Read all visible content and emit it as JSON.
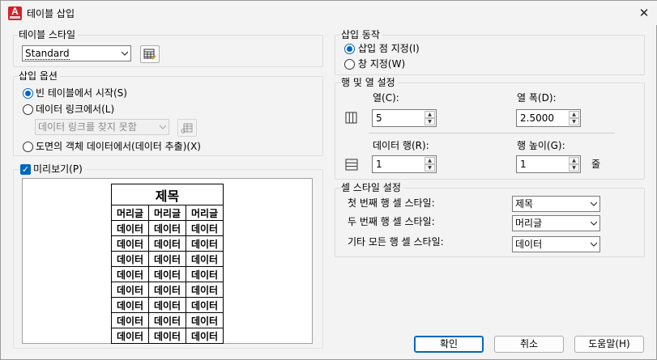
{
  "window": {
    "title": "테이블 삽입",
    "close": "✕"
  },
  "table_style": {
    "group_label": "테이블 스타일",
    "selected": "Standard"
  },
  "insert_options": {
    "group_label": "삽입 옵션",
    "opt_empty": "빈 테이블에서 시작(S)",
    "opt_link": "데이터 링크에서(L)",
    "link_combo": "데이터 링크를 찾지 못함",
    "opt_object": "도면의 객체 데이터에서(데이터 추출)(X)"
  },
  "preview": {
    "label": "미리보기(P)",
    "table": {
      "title": "제목",
      "headers": [
        "머리글",
        "머리글",
        "머리글"
      ],
      "rows": [
        [
          "데이터",
          "데이터",
          "데이터"
        ],
        [
          "데이터",
          "데이터",
          "데이터"
        ],
        [
          "데이터",
          "데이터",
          "데이터"
        ],
        [
          "데이터",
          "데이터",
          "데이터"
        ],
        [
          "데이터",
          "데이터",
          "데이터"
        ],
        [
          "데이터",
          "데이터",
          "데이터"
        ],
        [
          "데이터",
          "데이터",
          "데이터"
        ],
        [
          "데이터",
          "데이터",
          "데이터"
        ]
      ]
    }
  },
  "insert_behavior": {
    "group_label": "삽입 동작",
    "opt_point": "삽입 점 지정(I)",
    "opt_window": "창 지정(W)"
  },
  "row_col": {
    "group_label": "행 및 열 설정",
    "columns_label": "열(C):",
    "columns_value": "5",
    "col_width_label": "열 폭(D):",
    "col_width_value": "2.5000",
    "data_rows_label": "데이터 행(R):",
    "data_rows_value": "1",
    "row_height_label": "행 높이(G):",
    "row_height_value": "1",
    "row_height_unit": "줄"
  },
  "cell_style": {
    "group_label": "셀 스타일 설정",
    "first_row_label": "첫 번째 행 셀 스타일:",
    "first_row_value": "제목",
    "second_row_label": "두 번째 행 셀 스타일:",
    "second_row_value": "머리글",
    "other_rows_label": "기타 모든 행 셀 스타일:",
    "other_rows_value": "데이터"
  },
  "buttons": {
    "ok": "확인",
    "cancel": "취소",
    "help": "도움말(H)"
  },
  "colors": {
    "accent": "#0067c0",
    "app_icon": "#d2232a"
  }
}
